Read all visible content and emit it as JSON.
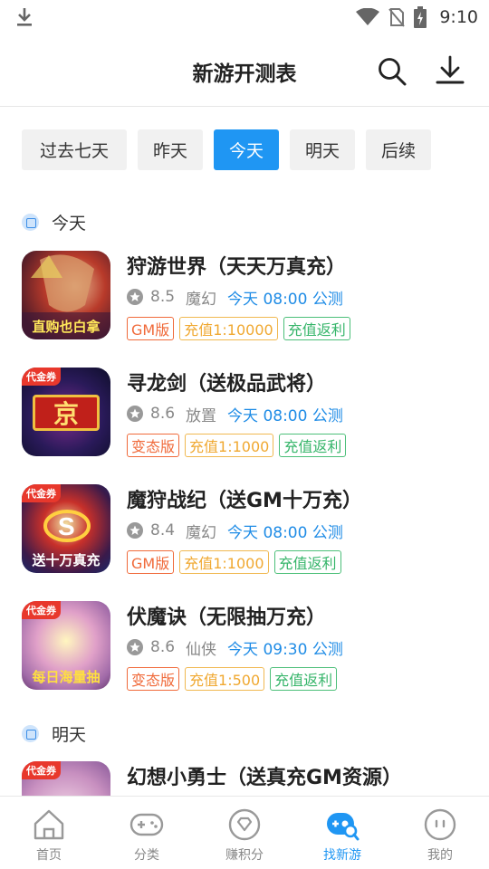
{
  "status_bar": {
    "time": "9:10"
  },
  "header": {
    "title": "新游开测表"
  },
  "tabs": [
    {
      "label": "过去七天",
      "active": false
    },
    {
      "label": "昨天",
      "active": false
    },
    {
      "label": "今天",
      "active": true
    },
    {
      "label": "明天",
      "active": false
    },
    {
      "label": "后续",
      "active": false
    }
  ],
  "sections": [
    {
      "title": "今天",
      "games": [
        {
          "name": "狩游世界（天天万真充）",
          "rating": "8.5",
          "genre": "魔幻",
          "open_time": "今天 08:00 公测",
          "tags": [
            {
              "text": "GM版",
              "color": "red"
            },
            {
              "text": "充值1:10000",
              "color": "orange"
            },
            {
              "text": "充值返利",
              "color": "green"
            }
          ],
          "icon_caption": "直购也白拿"
        },
        {
          "name": "寻龙剑（送极品武将）",
          "rating": "8.6",
          "genre": "放置",
          "open_time": "今天 08:00 公测",
          "tags": [
            {
              "text": "变态版",
              "color": "red"
            },
            {
              "text": "充值1:1000",
              "color": "orange"
            },
            {
              "text": "充值返利",
              "color": "green"
            }
          ],
          "icon_badge": "代金券",
          "icon_caption": "京"
        },
        {
          "name": "魔狩战纪（送GM十万充）",
          "rating": "8.4",
          "genre": "魔幻",
          "open_time": "今天 08:00 公测",
          "tags": [
            {
              "text": "GM版",
              "color": "red"
            },
            {
              "text": "充值1:1000",
              "color": "orange"
            },
            {
              "text": "充值返利",
              "color": "green"
            }
          ],
          "icon_badge": "代金券",
          "icon_caption": "送十万真充"
        },
        {
          "name": "伏魔诀（无限抽万充）",
          "rating": "8.6",
          "genre": "仙侠",
          "open_time": "今天 09:30 公测",
          "tags": [
            {
              "text": "变态版",
              "color": "red"
            },
            {
              "text": "充值1:500",
              "color": "orange"
            },
            {
              "text": "充值返利",
              "color": "green"
            }
          ],
          "icon_badge": "代金券",
          "icon_caption": "每日海量抽"
        }
      ]
    },
    {
      "title": "明天",
      "games": [
        {
          "name": "幻想小勇士（送真充GM资源）",
          "icon_badge": "代金券"
        }
      ]
    }
  ],
  "bottom_nav": [
    {
      "label": "首页",
      "icon": "home-icon",
      "active": false
    },
    {
      "label": "分类",
      "icon": "gamepad-icon",
      "active": false
    },
    {
      "label": "赚积分",
      "icon": "diamond-icon",
      "active": false
    },
    {
      "label": "找新游",
      "icon": "find-game-icon",
      "active": true
    },
    {
      "label": "我的",
      "icon": "profile-icon",
      "active": false
    }
  ],
  "colors": {
    "accent": "#1f96f3",
    "tag_red": "#f06a3a",
    "tag_orange": "#f0a830",
    "tag_green": "#36b56a"
  }
}
